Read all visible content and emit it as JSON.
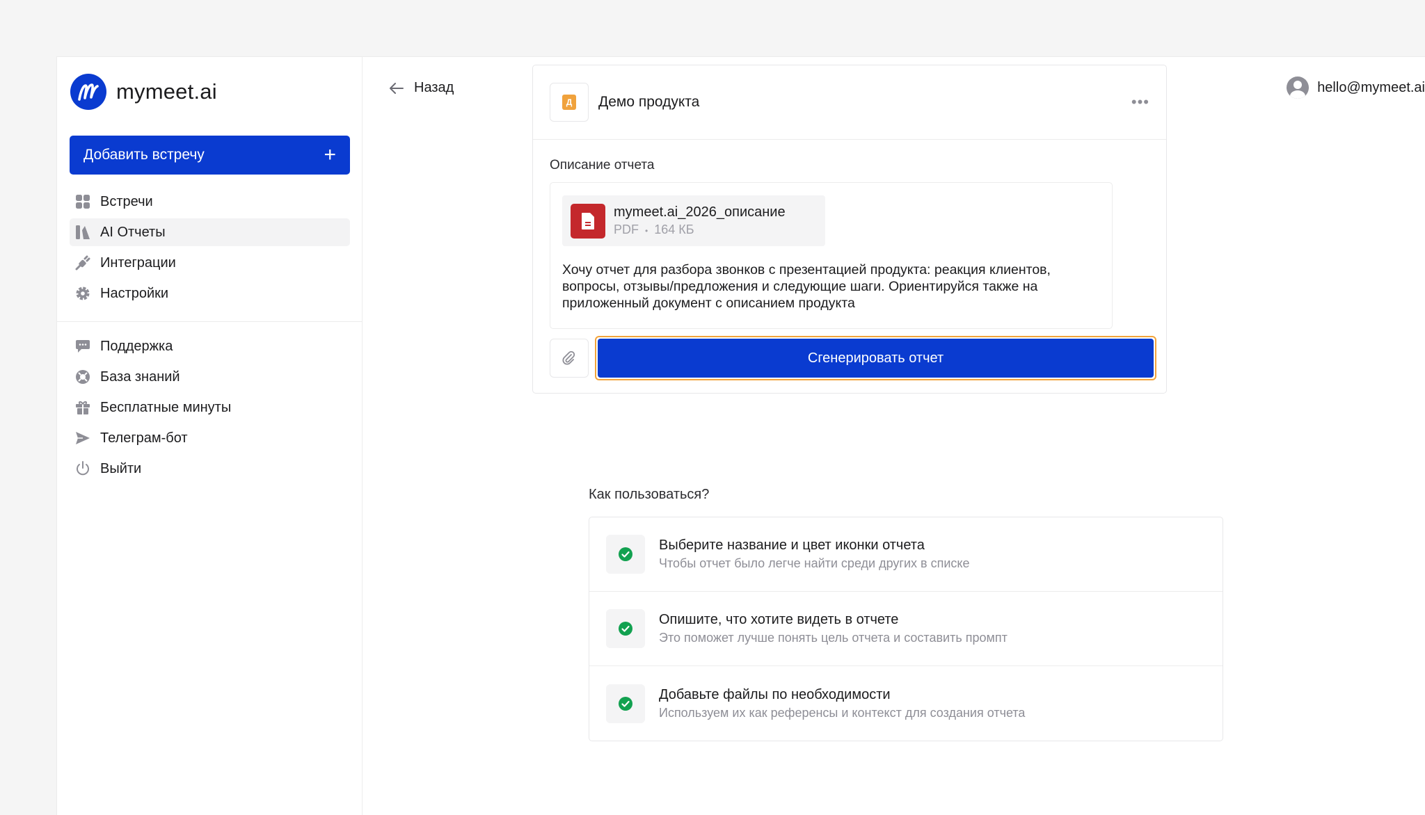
{
  "brand": {
    "name": "mymeet.ai",
    "color": "#0a3bd0"
  },
  "sidebar": {
    "add_meeting_label": "Добавить встречу",
    "primary": [
      {
        "label": "Встречи",
        "icon": "grid-icon"
      },
      {
        "label": "AI Отчеты",
        "icon": "reports-icon",
        "active": true
      },
      {
        "label": "Интеграции",
        "icon": "plug-icon"
      },
      {
        "label": "Настройки",
        "icon": "gear-icon"
      }
    ],
    "secondary": [
      {
        "label": "Поддержка",
        "icon": "chat-icon"
      },
      {
        "label": "База знаний",
        "icon": "lifebuoy-icon"
      },
      {
        "label": "Бесплатные минуты",
        "icon": "gift-icon"
      },
      {
        "label": "Телеграм-бот",
        "icon": "send-icon"
      },
      {
        "label": "Выйти",
        "icon": "power-icon"
      }
    ]
  },
  "header": {
    "back_label": "Назад",
    "user_email": "hello@mymeet.ai"
  },
  "report": {
    "badge_letter": "Д",
    "title": "Демо продукта",
    "description_label": "Описание отчета",
    "file": {
      "name": "mymeet.ai_2026_описание",
      "type": "PDF",
      "separator": "•",
      "size": "164 КБ"
    },
    "description_text": "Хочу отчет для разбора звонков с презентацией продукта: реакция клиентов, вопросы, отзывы/предложения и следующие шаги. Ориентируйся также на приложенный документ с описанием продукта",
    "generate_label": "Сгенерировать отчет"
  },
  "howto": {
    "title": "Как пользоваться?",
    "steps": [
      {
        "title": "Выберите название и цвет иконки отчета",
        "subtitle": "Чтобы отчет было легче найти среди других в списке"
      },
      {
        "title": "Опишите, что хотите видеть в отчете",
        "subtitle": "Это поможет лучше понять цель отчета и составить промпт"
      },
      {
        "title": "Добавьте файлы по необходимости",
        "subtitle": "Используем их как референсы и контекст для создания отчета"
      }
    ]
  }
}
